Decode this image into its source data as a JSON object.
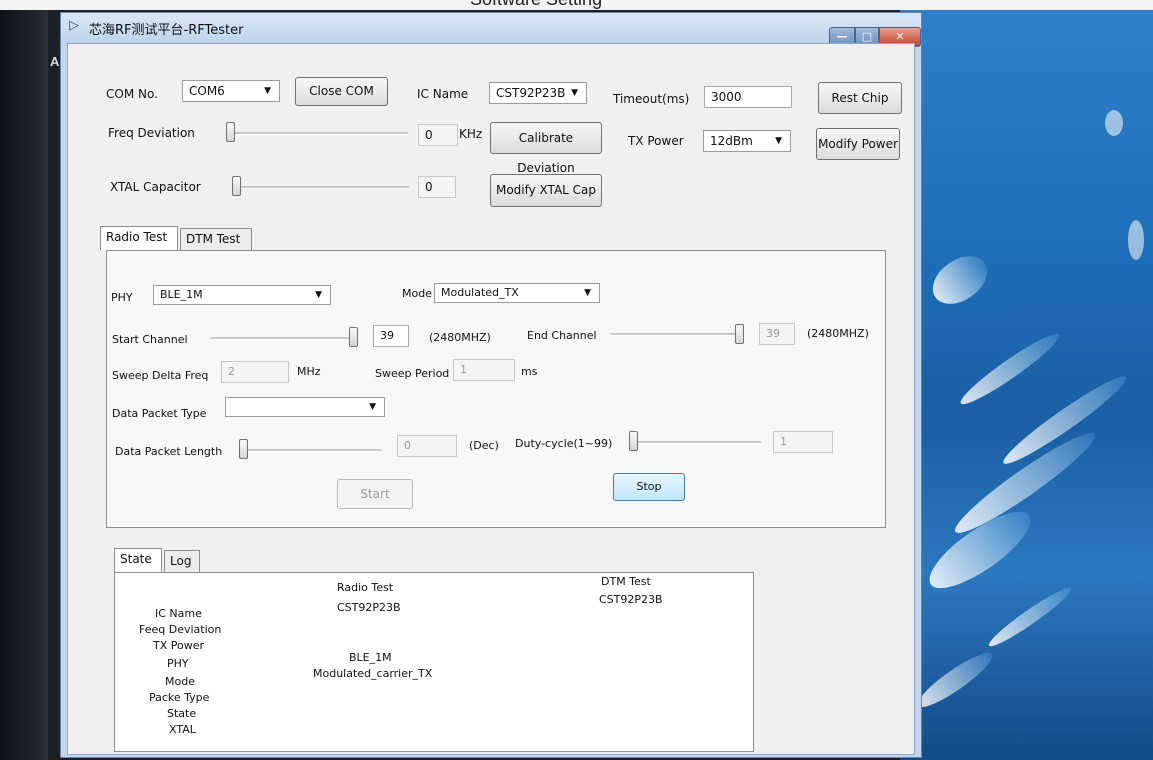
{
  "caption": "Software Setting",
  "desktop_letter": "A",
  "window": {
    "title_icon": "play-icon",
    "title": "芯海RF测试平台-RFTester",
    "controls": {
      "minimize": "—",
      "maximize": "□",
      "close": "✕"
    }
  },
  "top": {
    "com_no_label": "COM No.",
    "com_no_value": "COM6",
    "close_com_button": "Close COM",
    "ic_name_label": "IC Name",
    "ic_name_value": "CST92P23B",
    "timeout_label": "Timeout(ms)",
    "timeout_value": "3000",
    "rest_chip_button": "Rest Chip",
    "freq_dev_label": "Freq Deviation",
    "freq_dev_value": "0",
    "freq_dev_unit": "KHz",
    "calibrate_button": "Calibrate Deviation",
    "tx_power_label": "TX Power",
    "tx_power_value": "12dBm",
    "modify_power_button": "Modify Power",
    "xtal_label": "XTAL Capacitor",
    "xtal_value": "0",
    "modify_xtal_button": "Modify XTAL Cap"
  },
  "tabs": {
    "radio_test": "Radio Test",
    "dtm_test": "DTM Test"
  },
  "radio": {
    "phy_label": "PHY",
    "phy_value": "BLE_1M",
    "mode_label": "Mode",
    "mode_value": "Modulated_TX",
    "start_channel_label": "Start Channel",
    "start_channel_value": "39",
    "start_channel_freq": "(2480MHZ)",
    "end_channel_label": "End Channel",
    "end_channel_value": "39",
    "end_channel_freq": "(2480MHZ)",
    "sweep_delta_label": "Sweep Delta Freq",
    "sweep_delta_value": "2",
    "sweep_delta_unit": "MHz",
    "sweep_period_label": "Sweep Period",
    "sweep_period_value": "1",
    "sweep_period_unit": "ms",
    "packet_type_label": "Data Packet Type",
    "packet_type_value": "",
    "packet_length_label": "Data Packet Length",
    "packet_length_value": "0",
    "packet_length_unit": "(Dec)",
    "duty_cycle_label": "Duty-cycle(1~99)",
    "duty_cycle_value": "1",
    "start_button": "Start",
    "stop_button": "Stop",
    "start_channel_level": 1.0,
    "end_channel_level": 1.0,
    "freq_dev_level": 0,
    "xtal_level": 0,
    "packet_length_level": 0,
    "duty_cycle_level": 0
  },
  "bottom_tabs": {
    "state": "State",
    "log": "Log"
  },
  "state_table": {
    "headers": {
      "radio": "Radio Test",
      "dtm": "DTM Test"
    },
    "rows": [
      "IC Name",
      "Feeq Deviation",
      "TX Power",
      "PHY",
      "Mode",
      "Packe Type",
      "State",
      "XTAL"
    ],
    "radio_values": {
      "ic_name": "CST92P23B",
      "phy": "BLE_1M",
      "mode": "Modulated_carrier_TX"
    },
    "dtm_values": {
      "ic_name": "CST92P23B"
    }
  }
}
